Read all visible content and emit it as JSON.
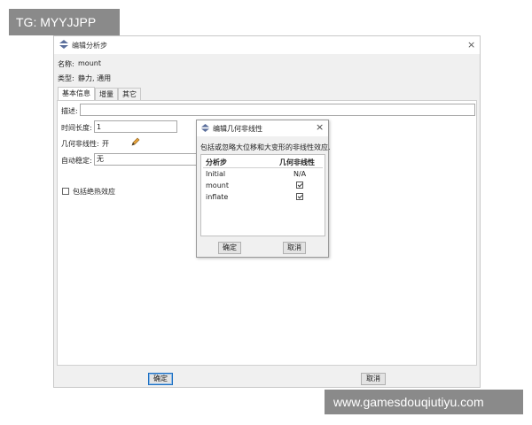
{
  "watermarks": {
    "top_left": "TG: MYYJJPP",
    "bottom_right": "www.gamesdouqiutiyu.com"
  },
  "main_dialog": {
    "title": "编辑分析步",
    "close_glyph": "×",
    "name_label": "名称:",
    "name_value": "mount",
    "type_label": "类型:",
    "type_value": "静力, 通用",
    "tabs": [
      {
        "label": "基本信息",
        "active": true
      },
      {
        "label": "增量",
        "active": false
      },
      {
        "label": "其它",
        "active": false
      }
    ],
    "description_label": "描述:",
    "description_value": "",
    "time_period_label": "时间长度:",
    "time_period_value": "1",
    "nlgeom_label": "几何非线性:",
    "nlgeom_value": "开",
    "stabilization_label": "自动稳定:",
    "stabilization_value": "无",
    "adiabatic_label": "包括绝热效应",
    "adiabatic_checked": false,
    "ok_label": "确定",
    "cancel_label": "取消"
  },
  "sub_dialog": {
    "title": "编辑几何非线性",
    "close_glyph": "×",
    "description": "包括或忽略大位移和大变形的非线性效应.",
    "columns": [
      "分析步",
      "几何非线性"
    ],
    "rows": [
      {
        "step": "Initial",
        "value": "N/A",
        "checked": null
      },
      {
        "step": "mount",
        "value": "",
        "checked": true
      },
      {
        "step": "inflate",
        "value": "",
        "checked": true
      }
    ],
    "ok_label": "确定",
    "cancel_label": "取消"
  },
  "icons": {
    "app_icon": "abaqus-step-icon",
    "edit_icon": "pencil-icon"
  },
  "colors": {
    "primary_button_border": "#1b6fc2",
    "watermark_bg": "#8a8a8a"
  }
}
